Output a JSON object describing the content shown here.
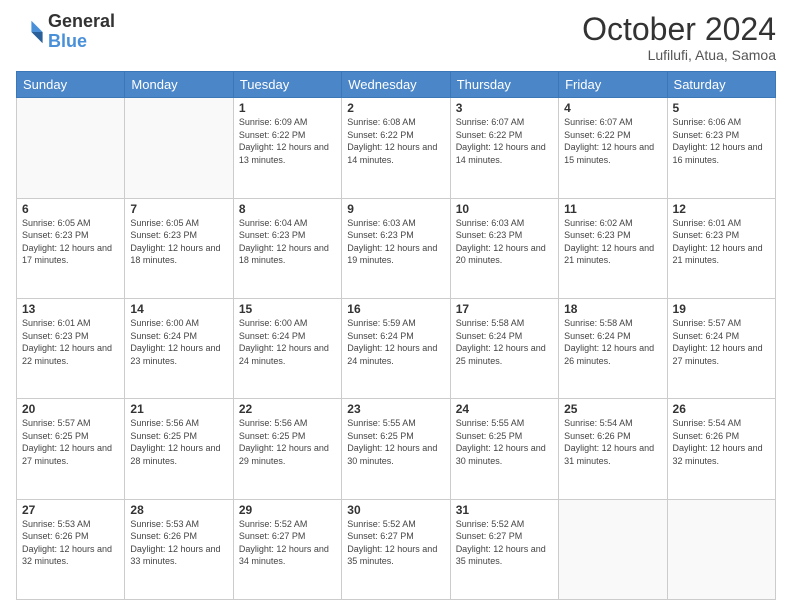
{
  "header": {
    "logo_line1": "General",
    "logo_line2": "Blue",
    "month_title": "October 2024",
    "location": "Lufilufi, Atua, Samoa"
  },
  "days_of_week": [
    "Sunday",
    "Monday",
    "Tuesday",
    "Wednesday",
    "Thursday",
    "Friday",
    "Saturday"
  ],
  "weeks": [
    [
      {
        "day": "",
        "info": ""
      },
      {
        "day": "",
        "info": ""
      },
      {
        "day": "1",
        "info": "Sunrise: 6:09 AM\nSunset: 6:22 PM\nDaylight: 12 hours and 13 minutes."
      },
      {
        "day": "2",
        "info": "Sunrise: 6:08 AM\nSunset: 6:22 PM\nDaylight: 12 hours and 14 minutes."
      },
      {
        "day": "3",
        "info": "Sunrise: 6:07 AM\nSunset: 6:22 PM\nDaylight: 12 hours and 14 minutes."
      },
      {
        "day": "4",
        "info": "Sunrise: 6:07 AM\nSunset: 6:22 PM\nDaylight: 12 hours and 15 minutes."
      },
      {
        "day": "5",
        "info": "Sunrise: 6:06 AM\nSunset: 6:23 PM\nDaylight: 12 hours and 16 minutes."
      }
    ],
    [
      {
        "day": "6",
        "info": "Sunrise: 6:05 AM\nSunset: 6:23 PM\nDaylight: 12 hours and 17 minutes."
      },
      {
        "day": "7",
        "info": "Sunrise: 6:05 AM\nSunset: 6:23 PM\nDaylight: 12 hours and 18 minutes."
      },
      {
        "day": "8",
        "info": "Sunrise: 6:04 AM\nSunset: 6:23 PM\nDaylight: 12 hours and 18 minutes."
      },
      {
        "day": "9",
        "info": "Sunrise: 6:03 AM\nSunset: 6:23 PM\nDaylight: 12 hours and 19 minutes."
      },
      {
        "day": "10",
        "info": "Sunrise: 6:03 AM\nSunset: 6:23 PM\nDaylight: 12 hours and 20 minutes."
      },
      {
        "day": "11",
        "info": "Sunrise: 6:02 AM\nSunset: 6:23 PM\nDaylight: 12 hours and 21 minutes."
      },
      {
        "day": "12",
        "info": "Sunrise: 6:01 AM\nSunset: 6:23 PM\nDaylight: 12 hours and 21 minutes."
      }
    ],
    [
      {
        "day": "13",
        "info": "Sunrise: 6:01 AM\nSunset: 6:23 PM\nDaylight: 12 hours and 22 minutes."
      },
      {
        "day": "14",
        "info": "Sunrise: 6:00 AM\nSunset: 6:24 PM\nDaylight: 12 hours and 23 minutes."
      },
      {
        "day": "15",
        "info": "Sunrise: 6:00 AM\nSunset: 6:24 PM\nDaylight: 12 hours and 24 minutes."
      },
      {
        "day": "16",
        "info": "Sunrise: 5:59 AM\nSunset: 6:24 PM\nDaylight: 12 hours and 24 minutes."
      },
      {
        "day": "17",
        "info": "Sunrise: 5:58 AM\nSunset: 6:24 PM\nDaylight: 12 hours and 25 minutes."
      },
      {
        "day": "18",
        "info": "Sunrise: 5:58 AM\nSunset: 6:24 PM\nDaylight: 12 hours and 26 minutes."
      },
      {
        "day": "19",
        "info": "Sunrise: 5:57 AM\nSunset: 6:24 PM\nDaylight: 12 hours and 27 minutes."
      }
    ],
    [
      {
        "day": "20",
        "info": "Sunrise: 5:57 AM\nSunset: 6:25 PM\nDaylight: 12 hours and 27 minutes."
      },
      {
        "day": "21",
        "info": "Sunrise: 5:56 AM\nSunset: 6:25 PM\nDaylight: 12 hours and 28 minutes."
      },
      {
        "day": "22",
        "info": "Sunrise: 5:56 AM\nSunset: 6:25 PM\nDaylight: 12 hours and 29 minutes."
      },
      {
        "day": "23",
        "info": "Sunrise: 5:55 AM\nSunset: 6:25 PM\nDaylight: 12 hours and 30 minutes."
      },
      {
        "day": "24",
        "info": "Sunrise: 5:55 AM\nSunset: 6:25 PM\nDaylight: 12 hours and 30 minutes."
      },
      {
        "day": "25",
        "info": "Sunrise: 5:54 AM\nSunset: 6:26 PM\nDaylight: 12 hours and 31 minutes."
      },
      {
        "day": "26",
        "info": "Sunrise: 5:54 AM\nSunset: 6:26 PM\nDaylight: 12 hours and 32 minutes."
      }
    ],
    [
      {
        "day": "27",
        "info": "Sunrise: 5:53 AM\nSunset: 6:26 PM\nDaylight: 12 hours and 32 minutes."
      },
      {
        "day": "28",
        "info": "Sunrise: 5:53 AM\nSunset: 6:26 PM\nDaylight: 12 hours and 33 minutes."
      },
      {
        "day": "29",
        "info": "Sunrise: 5:52 AM\nSunset: 6:27 PM\nDaylight: 12 hours and 34 minutes."
      },
      {
        "day": "30",
        "info": "Sunrise: 5:52 AM\nSunset: 6:27 PM\nDaylight: 12 hours and 35 minutes."
      },
      {
        "day": "31",
        "info": "Sunrise: 5:52 AM\nSunset: 6:27 PM\nDaylight: 12 hours and 35 minutes."
      },
      {
        "day": "",
        "info": ""
      },
      {
        "day": "",
        "info": ""
      }
    ]
  ]
}
